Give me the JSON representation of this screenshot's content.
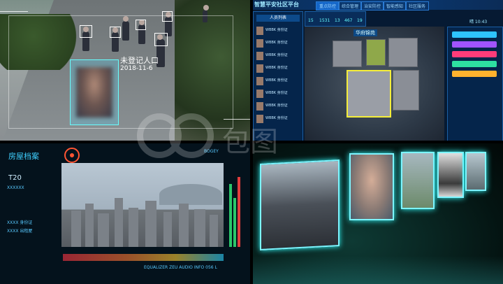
{
  "street": {
    "label": "未登记人口",
    "date": "2018-11-6"
  },
  "platform": {
    "title": "智慧平安社区平台",
    "tabs": [
      "重点防控",
      "综合管理",
      "治安防控",
      "智能感知",
      "社区服务"
    ],
    "stats": [
      "15",
      "1531",
      "13",
      "467",
      "19"
    ],
    "map_name": "华府锦苑",
    "list_header": "人员列表",
    "list_items": [
      "WBBK 身份证",
      "WBBK 身份证",
      "WBBK 身份证",
      "WBBK 身份证",
      "WBBK 身份证",
      "WBBK 身份证",
      "WBBK 身份证",
      "WBBK 身份证"
    ],
    "clock": "晴 10:43",
    "colors": [
      "#2ec4ff",
      "#a154ff",
      "#ff3c7a",
      "#2ee0a1",
      "#ffb22e"
    ]
  },
  "housing": {
    "title": "房屋档案",
    "code": "T20",
    "side_texts": [
      "XXXXXX",
      "XXXX 身份证",
      "XXXX 出租屋"
    ],
    "footer": "EQUALIZER ZEU AUDIO INFO 056 L",
    "tech": "BOGEY"
  },
  "watermark": "包图"
}
